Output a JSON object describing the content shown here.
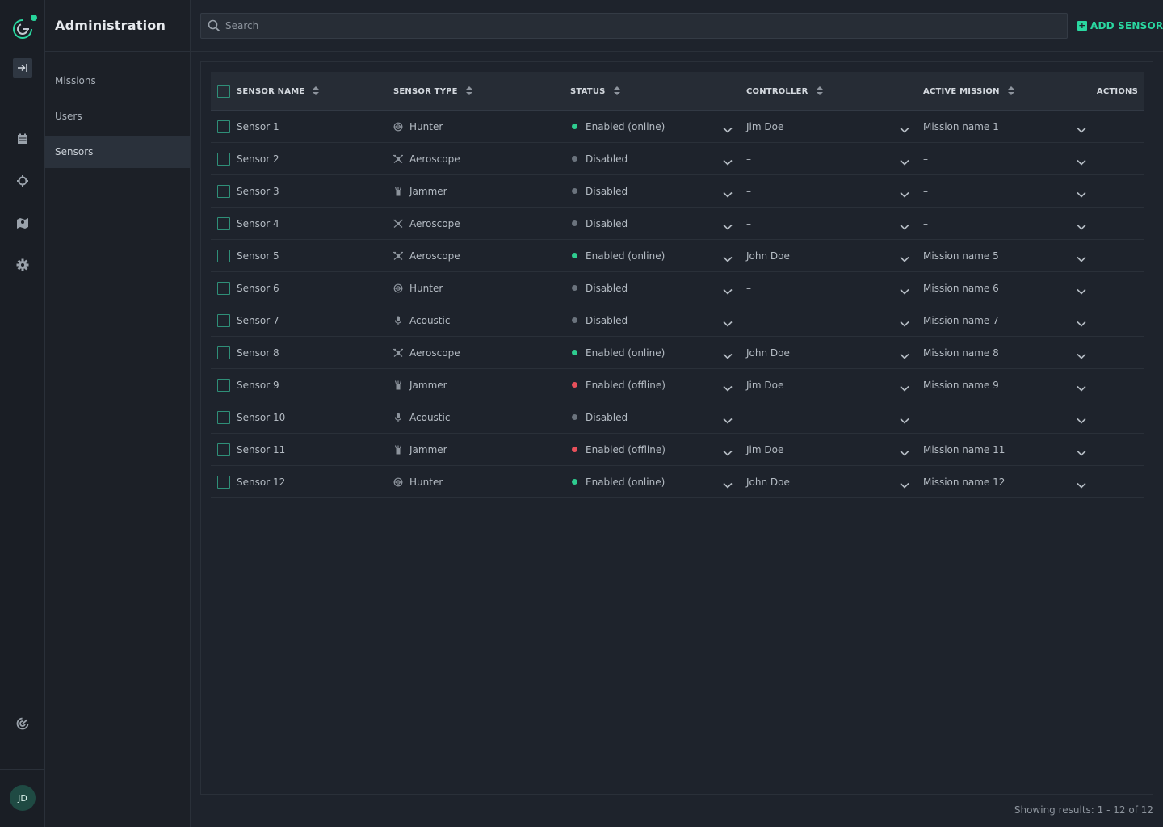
{
  "colors": {
    "accent": "#2ad8a1",
    "online": "#2ecc8f",
    "offline": "#e8505b",
    "disabled": "#6b737d"
  },
  "rail": {
    "icons": [
      "app-logo-icon",
      "collapse-panel-icon",
      "calendar-icon",
      "crosshair-icon",
      "map-icon",
      "gear-icon",
      "radar-icon"
    ],
    "avatar_initials": "JD"
  },
  "sidebar": {
    "title": "Administration",
    "items": [
      {
        "label": "Missions"
      },
      {
        "label": "Users"
      },
      {
        "label": "Sensors",
        "active": true
      }
    ]
  },
  "topbar": {
    "search_placeholder": "Search",
    "add_button_label": "ADD SENSOR"
  },
  "table": {
    "columns": {
      "name": "SENSOR NAME",
      "type": "SENSOR TYPE",
      "status": "STATUS",
      "controller": "CONTROLLER",
      "mission": "ACTIVE MISSION",
      "actions": "ACTIONS"
    },
    "rows": [
      {
        "name": "Sensor 1",
        "type": "Hunter",
        "type_icon": "hunter-icon",
        "status": "Enabled (online)",
        "state": "online",
        "controller": "Jim Doe",
        "mission": "Mission name 1"
      },
      {
        "name": "Sensor 2",
        "type": "Aeroscope",
        "type_icon": "drone-icon",
        "status": "Disabled",
        "state": "disabled",
        "controller": "–",
        "mission": "–"
      },
      {
        "name": "Sensor 3",
        "type": "Jammer",
        "type_icon": "jammer-icon",
        "status": "Disabled",
        "state": "disabled",
        "controller": "–",
        "mission": "–"
      },
      {
        "name": "Sensor 4",
        "type": "Aeroscope",
        "type_icon": "drone-icon",
        "status": "Disabled",
        "state": "disabled",
        "controller": "–",
        "mission": "–"
      },
      {
        "name": "Sensor 5",
        "type": "Aeroscope",
        "type_icon": "drone-icon",
        "status": "Enabled (online)",
        "state": "online",
        "controller": "John Doe",
        "mission": "Mission name 5"
      },
      {
        "name": "Sensor 6",
        "type": "Hunter",
        "type_icon": "hunter-icon",
        "status": "Disabled",
        "state": "disabled",
        "controller": "–",
        "mission": "Mission name 6"
      },
      {
        "name": "Sensor 7",
        "type": "Acoustic",
        "type_icon": "microphone-icon",
        "status": "Disabled",
        "state": "disabled",
        "controller": "–",
        "mission": "Mission name 7"
      },
      {
        "name": "Sensor 8",
        "type": "Aeroscope",
        "type_icon": "drone-icon",
        "status": "Enabled (online)",
        "state": "online",
        "controller": "John Doe",
        "mission": "Mission name 8"
      },
      {
        "name": "Sensor 9",
        "type": "Jammer",
        "type_icon": "jammer-icon",
        "status": "Enabled (offline)",
        "state": "offline",
        "controller": "Jim Doe",
        "mission": "Mission name 9"
      },
      {
        "name": "Sensor 10",
        "type": "Acoustic",
        "type_icon": "microphone-icon",
        "status": "Disabled",
        "state": "disabled",
        "controller": "–",
        "mission": "–"
      },
      {
        "name": "Sensor 11",
        "type": "Jammer",
        "type_icon": "jammer-icon",
        "status": "Enabled (offline)",
        "state": "offline",
        "controller": "Jim Doe",
        "mission": "Mission name 11"
      },
      {
        "name": "Sensor 12",
        "type": "Hunter",
        "type_icon": "hunter-icon",
        "status": "Enabled (online)",
        "state": "online",
        "controller": "John Doe",
        "mission": "Mission name 12"
      }
    ]
  },
  "footer": {
    "results_text": "Showing results: 1 - 12 of 12"
  }
}
